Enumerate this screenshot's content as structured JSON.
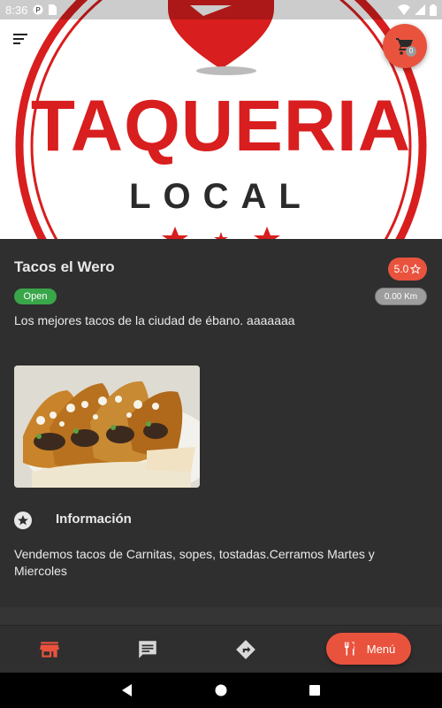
{
  "status_bar": {
    "time": "8:36",
    "icons_left": [
      "notification-dot-icon",
      "sim-card-icon"
    ],
    "icons_right": [
      "wifi-icon",
      "signal-icon",
      "battery-icon"
    ]
  },
  "hero": {
    "logo_main": "TAQUERIA",
    "logo_sub": "LOCAL",
    "brand_color": "#d81e1e"
  },
  "header": {
    "menu_icon": "sort-icon",
    "cart_icon": "cart-icon",
    "cart_count": "0"
  },
  "restaurant": {
    "name": "Tacos el Wero",
    "rating": "5.0",
    "status": "Open",
    "distance": "0.00 Km",
    "description": "Los mejores tacos de la ciudad de ébano. aaaaaaa"
  },
  "info": {
    "title": "Información",
    "text": "Vendemos tacos de Carnitas, sopes, tostadas.Cerramos Martes y Miercoles"
  },
  "bottom_nav": {
    "items": [
      {
        "icon": "store-icon",
        "active": true
      },
      {
        "icon": "chat-icon",
        "active": false
      },
      {
        "icon": "directions-icon",
        "active": false
      }
    ],
    "menu_label": "Menú"
  },
  "colors": {
    "accent": "#e9533e",
    "background": "#2f2f2f",
    "open_green": "#3aa64a",
    "badge_gray": "#9d9d9d"
  }
}
